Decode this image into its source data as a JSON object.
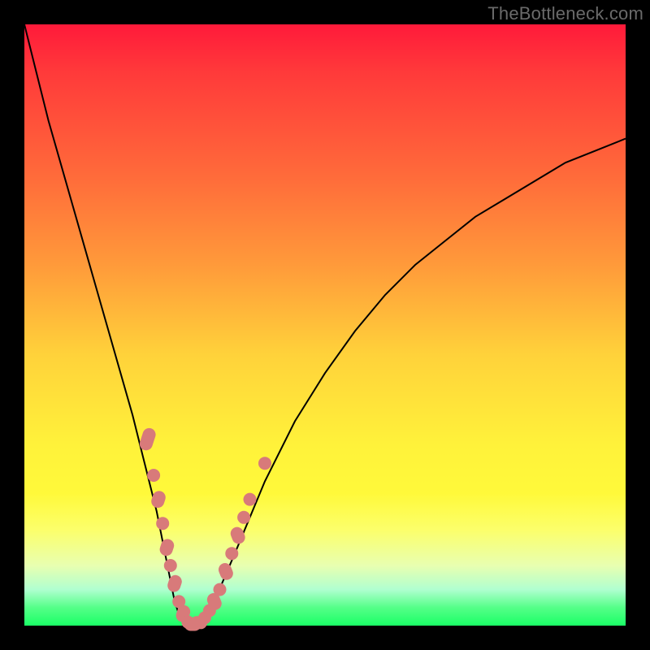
{
  "watermark": "TheBottleneck.com",
  "colors": {
    "background_frame": "#000000",
    "curve": "#000000",
    "marker": "#d87a7a",
    "gradient_top": "#ff1a3a",
    "gradient_bottom": "#1aff66"
  },
  "chart_data": {
    "type": "line",
    "title": "",
    "xlabel": "",
    "ylabel": "",
    "xlim": [
      0,
      100
    ],
    "ylim": [
      0,
      100
    ],
    "grid": false,
    "legend": false,
    "series": [
      {
        "name": "bottleneck-curve",
        "x": [
          0,
          2,
          4,
          6,
          8,
          10,
          12,
          14,
          16,
          18,
          20,
          21,
          22,
          23,
          24,
          25,
          26,
          27,
          28,
          29,
          30,
          32,
          35,
          40,
          45,
          50,
          55,
          60,
          65,
          70,
          75,
          80,
          85,
          90,
          95,
          100
        ],
        "y": [
          100,
          92,
          84,
          77,
          70,
          63,
          56,
          49,
          42,
          35,
          27,
          23,
          19,
          14,
          9,
          4,
          1,
          0.3,
          0.1,
          0.6,
          1.5,
          5,
          12,
          24,
          34,
          42,
          49,
          55,
          60,
          64,
          68,
          71,
          74,
          77,
          79,
          81
        ]
      }
    ],
    "markers": {
      "name": "highlight-points",
      "points": [
        {
          "x": 20.5,
          "y": 31,
          "shape": "pill",
          "len": 4
        },
        {
          "x": 21.5,
          "y": 25,
          "shape": "dot"
        },
        {
          "x": 22.3,
          "y": 21,
          "shape": "pill",
          "len": 3
        },
        {
          "x": 23.0,
          "y": 17,
          "shape": "dot"
        },
        {
          "x": 23.7,
          "y": 13,
          "shape": "pill",
          "len": 3
        },
        {
          "x": 24.3,
          "y": 10,
          "shape": "dot"
        },
        {
          "x": 25.0,
          "y": 7,
          "shape": "pill",
          "len": 3
        },
        {
          "x": 25.7,
          "y": 4,
          "shape": "dot"
        },
        {
          "x": 26.4,
          "y": 2,
          "shape": "pill",
          "len": 3
        },
        {
          "x": 27.2,
          "y": 0.6,
          "shape": "dot"
        },
        {
          "x": 28.0,
          "y": 0.2,
          "shape": "hpill",
          "len": 3
        },
        {
          "x": 29.0,
          "y": 0.5,
          "shape": "hpill",
          "len": 3
        },
        {
          "x": 30.0,
          "y": 1.3,
          "shape": "dot"
        },
        {
          "x": 30.8,
          "y": 2.5,
          "shape": "dot"
        },
        {
          "x": 31.6,
          "y": 4,
          "shape": "pill",
          "len": 3
        },
        {
          "x": 32.5,
          "y": 6,
          "shape": "dot"
        },
        {
          "x": 33.5,
          "y": 9,
          "shape": "pill",
          "len": 3
        },
        {
          "x": 34.5,
          "y": 12,
          "shape": "dot"
        },
        {
          "x": 35.5,
          "y": 15,
          "shape": "pill",
          "len": 3
        },
        {
          "x": 36.5,
          "y": 18,
          "shape": "dot"
        },
        {
          "x": 37.5,
          "y": 21,
          "shape": "dot"
        },
        {
          "x": 40.0,
          "y": 27,
          "shape": "dot"
        }
      ]
    }
  }
}
